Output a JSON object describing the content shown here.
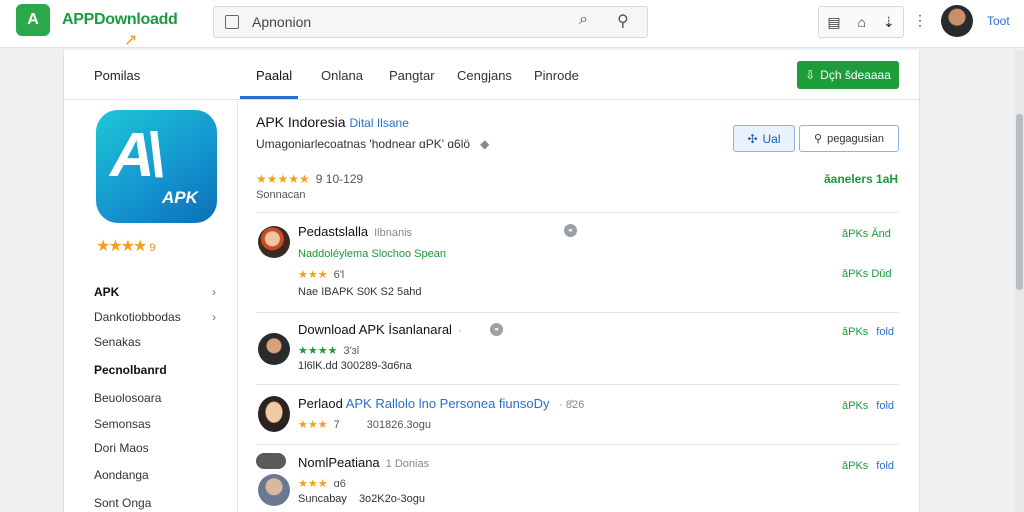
{
  "header": {
    "logo_mark": "A",
    "logo_text": "APPDownloadd",
    "search_value": "Apnonion",
    "tool_icons": [
      "document-icon",
      "home-icon",
      "share-icon"
    ],
    "user_link": "Toot"
  },
  "subnav": {
    "section_title": "Pomilas",
    "tabs": [
      "Paalal",
      "Onlana",
      "Pangtar",
      "Cengjans",
      "Pinrode"
    ],
    "cta_label": "Dçh šdeaaaa"
  },
  "sidebar": {
    "app_icon_mark": "A\\",
    "app_icon_apk": "APK",
    "rating_stars": "★★★★",
    "rating_value": "9",
    "items": [
      {
        "label": "APK",
        "chevron": "›"
      },
      {
        "label": "Dankotiobbodas",
        "chevron": "›"
      },
      {
        "label": "Senakas"
      },
      {
        "label": "Pecnolbanrd"
      },
      {
        "label": "Beuolosoara"
      },
      {
        "label": "Semonsas"
      },
      {
        "label": "Dori Maos"
      },
      {
        "label": "Aondanga"
      },
      {
        "label": "Sont Onga"
      }
    ]
  },
  "app": {
    "title": "APK Indoresia",
    "title_sub": "Dital Ilsane",
    "description": "Umagoniarlecoatnas 'hodnear ɑPK' ɑ6lö",
    "rating_stars": "★★★★★",
    "rating_value": "9 10-129",
    "rating_sub": "Sonnacan",
    "right_label": "ăanelers 1aH",
    "unlock_label": "Ual",
    "search_button_label": "pegagusian"
  },
  "rows": [
    {
      "title": "Pedastslalla",
      "extra": "Ilbnanis",
      "line2": "Naddoléylema Slochoo Spean",
      "stars": "★★★",
      "rating": "6'l",
      "meta": "Nae IBAPK  S0K S2 5ahd",
      "link": "ăPKs Ănd",
      "link2": "ǎPKs Dǔd"
    },
    {
      "title": "Download APK İsanlanaral",
      "stars": "★★★★",
      "rating": "3'ɜl",
      "meta": "1l6lK.dd  300289-3ɑ6na",
      "link": "ǎPKs",
      "link2": "fold"
    },
    {
      "title": "Perlaod",
      "title_blue": "APK Rallolo lno Personea fiunsoDy",
      "title_extra": "· 8̓26",
      "stars": "★★★",
      "rating": "7",
      "meta": "",
      "meta2": "301826.3ogu",
      "link": "ǎPKs",
      "link2": "fold"
    },
    {
      "title": "NomlPeatiana",
      "extra": "1 Donias",
      "stars": "★★★",
      "rating": "ɑ6",
      "meta": "Suncabay",
      "meta2": "3o2K2o-3ogu",
      "link": "ǎPKs",
      "link2": "fold"
    }
  ]
}
